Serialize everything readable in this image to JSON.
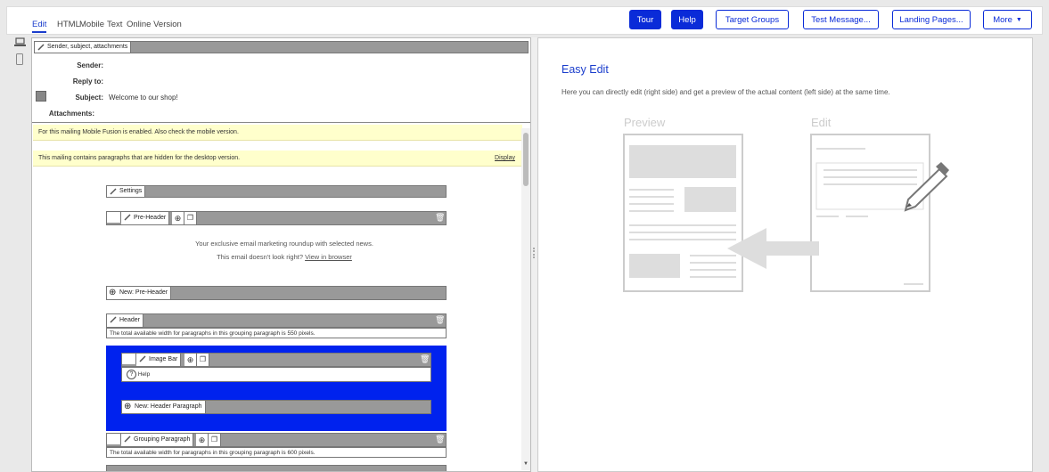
{
  "tabs": [
    {
      "label": "Edit"
    },
    {
      "label": "HTML"
    },
    {
      "label": "Mobile"
    },
    {
      "label": "Text"
    },
    {
      "label": "Online Version"
    }
  ],
  "toolbar": {
    "tour": "Tour",
    "help": "Help",
    "target_groups": "Target Groups",
    "test_message": "Test Message...",
    "landing_pages": "Landing Pages...",
    "more": "More"
  },
  "header_section": {
    "bar_label": "Sender, subject, attachments",
    "sender_label": "Sender:",
    "sender_value": "",
    "reply_label": "Reply to:",
    "reply_value": "",
    "subject_label": "Subject:",
    "subject_value": "Welcome to our shop!",
    "attachments_label": "Attachments:",
    "attachments_value": ""
  },
  "notices": {
    "mobile": "For this mailing Mobile Fusion is enabled. Also check the mobile version.",
    "hidden": "This mailing contains paragraphs that are hidden for the desktop version.",
    "hidden_action": "Display"
  },
  "blocks": {
    "settings": "Settings",
    "preheader": "Pre-Header",
    "preheader_line1": "Your exclusive email marketing roundup with selected news.",
    "preheader_line2": "This email doesn't look right?",
    "preheader_link": "View in browser",
    "new_preheader": "New: Pre-Header",
    "header": "Header",
    "header_info": "The total available width for paragraphs in this grouping paragraph is 550 pixels.",
    "image_bar": "Image Bar",
    "help": "Help",
    "new_header_paragraph": "New: Header Paragraph",
    "grouping": "Grouping Paragraph",
    "grouping_info": "The total available width for paragraphs in this grouping paragraph is 600 pixels."
  },
  "easy_edit": {
    "title": "Easy Edit",
    "description": "Here you can directly edit (right side) and get a preview of the actual content (left side) at the same time.",
    "preview_label": "Preview",
    "edit_label": "Edit"
  },
  "colors": {
    "accent": "#0a2bd8",
    "highlight": "#0022ee",
    "notice_bg": "#ffffcc"
  }
}
